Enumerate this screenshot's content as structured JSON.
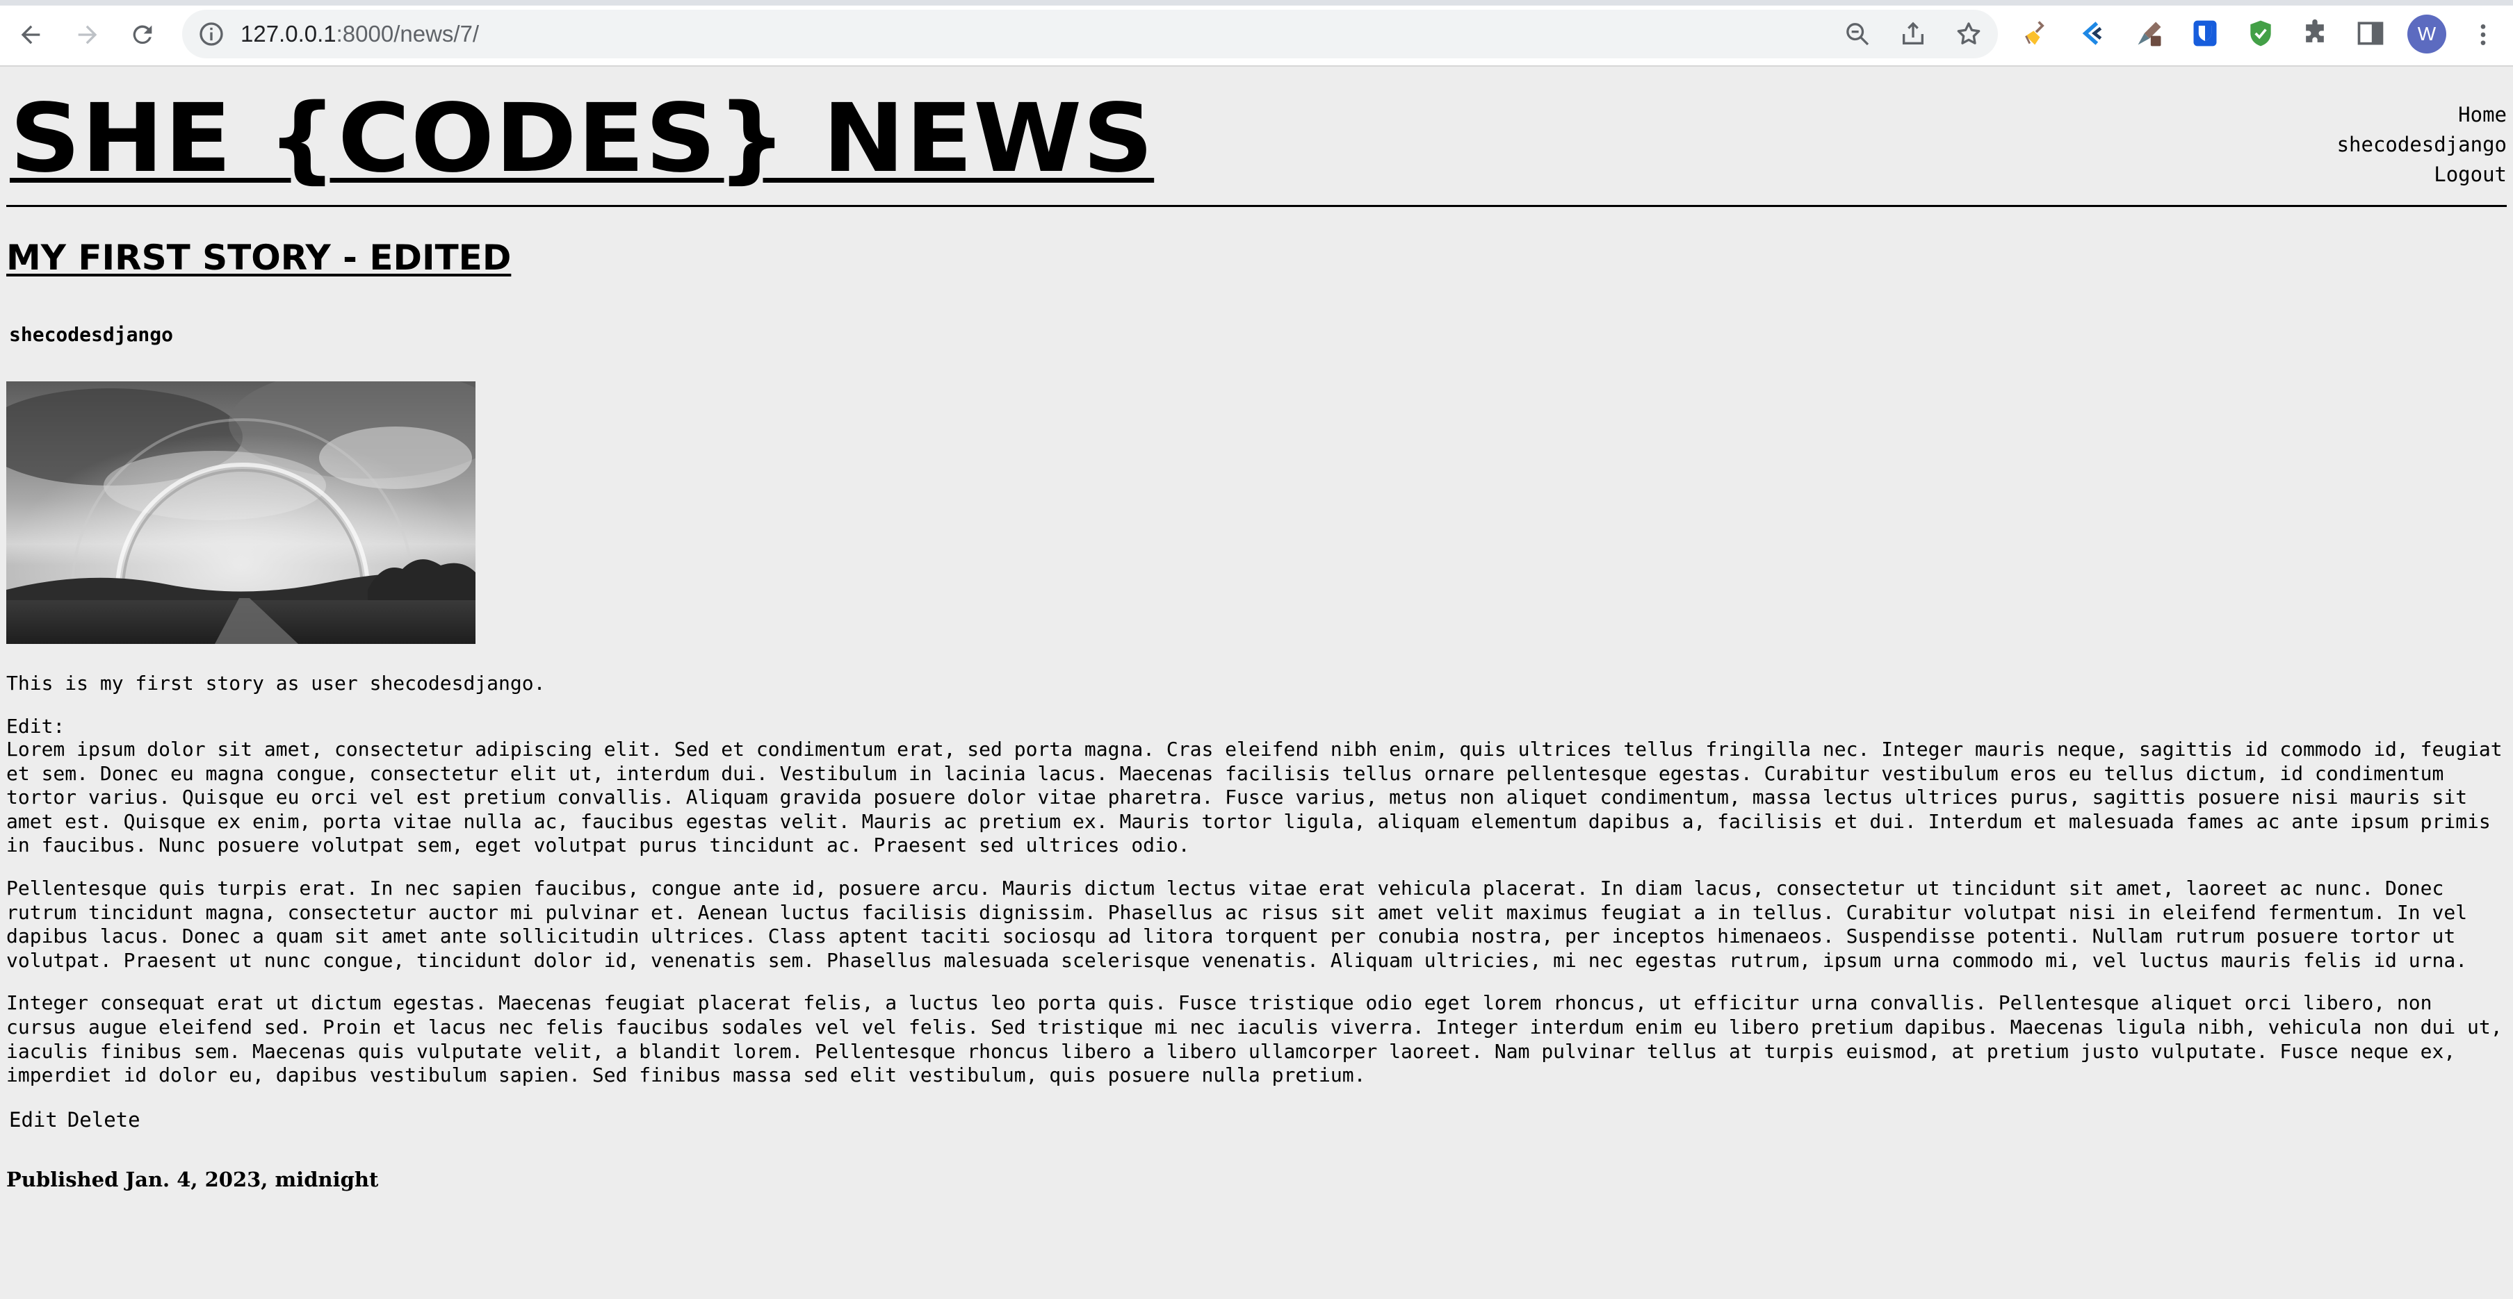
{
  "browser": {
    "url_host": "127.0.0.1",
    "url_path": ":8000/news/7/",
    "profile_initial": "W"
  },
  "site": {
    "title": "SHE {CODES} NEWS",
    "nav": [
      "Home",
      "shecodesdjango",
      "Logout"
    ]
  },
  "story": {
    "title": "MY FIRST STORY - EDITED",
    "author": "shecodesdjango",
    "intro": "This is my first story as user shecodesdjango.",
    "edit_label": "Edit:",
    "paragraphs": [
      "Lorem ipsum dolor sit amet, consectetur adipiscing elit. Sed et condimentum erat, sed porta magna. Cras eleifend nibh enim, quis ultrices tellus fringilla nec. Integer mauris neque, sagittis id commodo id, feugiat et sem. Donec eu magna congue, consectetur elit ut, interdum dui. Vestibulum in lacinia lacus. Maecenas facilisis tellus ornare pellentesque egestas. Curabitur vestibulum eros eu tellus dictum, id condimentum tortor varius. Quisque eu orci vel est pretium convallis. Aliquam gravida posuere dolor vitae pharetra. Fusce varius, metus non aliquet condimentum, massa lectus ultrices purus, sagittis posuere nisi mauris sit amet est. Quisque ex enim, porta vitae nulla ac, faucibus egestas velit. Mauris ac pretium ex. Mauris tortor ligula, aliquam elementum dapibus a, facilisis et dui. Interdum et malesuada fames ac ante ipsum primis in faucibus. Nunc posuere volutpat sem, eget volutpat purus tincidunt ac. Praesent sed ultrices odio.",
      "Pellentesque quis turpis erat. In nec sapien faucibus, congue ante id, posuere arcu. Mauris dictum lectus vitae erat vehicula placerat. In diam lacus, consectetur ut tincidunt sit amet, laoreet ac nunc. Donec rutrum tincidunt magna, consectetur auctor mi pulvinar et. Aenean luctus facilisis dignissim. Phasellus ac risus sit amet velit maximus feugiat a in tellus. Curabitur volutpat nisi in eleifend fermentum. In vel dapibus lacus. Donec a quam sit amet ante sollicitudin ultrices. Class aptent taciti sociosqu ad litora torquent per conubia nostra, per inceptos himenaeos. Suspendisse potenti. Nullam rutrum posuere tortor ut volutpat. Praesent ut nunc congue, tincidunt dolor id, venenatis sem. Phasellus malesuada scelerisque venenatis. Aliquam ultricies, mi nec egestas rutrum, ipsum urna commodo mi, vel luctus mauris felis id urna.",
      "Integer consequat erat ut dictum egestas. Maecenas feugiat placerat felis, a luctus leo porta quis. Fusce tristique odio eget lorem rhoncus, ut efficitur urna convallis. Pellentesque aliquet orci libero, non cursus augue eleifend sed. Proin et lacus nec felis faucibus sodales vel vel felis. Sed tristique mi nec iaculis viverra. Integer interdum enim eu libero pretium dapibus. Maecenas ligula nibh, vehicula non dui ut, iaculis finibus sem. Maecenas quis vulputate velit, a blandit lorem. Pellentesque rhoncus libero a libero ullamcorper laoreet. Nam pulvinar tellus at turpis euismod, at pretium justo vulputate. Fusce neque ex, imperdiet id dolor eu, dapibus vestibulum sapien. Sed finibus massa sed elit vestibulum, quis posuere nulla pretium."
    ],
    "edit_link": "Edit",
    "delete_link": "Delete",
    "published": "Published Jan. 4, 2023, midnight"
  }
}
